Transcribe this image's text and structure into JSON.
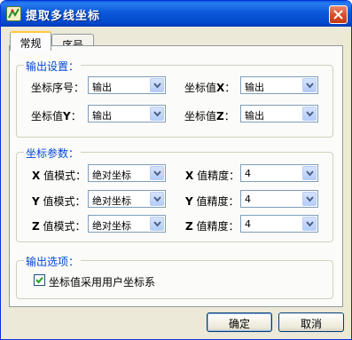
{
  "window": {
    "title": "提取多线坐标"
  },
  "tabs": [
    {
      "label": "常规"
    },
    {
      "label": "序号"
    }
  ],
  "output_settings": {
    "title": "输出设置：",
    "rows": [
      {
        "label": "坐标序号：",
        "value": "输出"
      },
      {
        "label_prefix": "坐标值",
        "label_axis": "X",
        "label_suffix": "：",
        "value": "输出"
      },
      {
        "label_prefix": "坐标值",
        "label_axis": "Y",
        "label_suffix": "：",
        "value": "输出"
      },
      {
        "label_prefix": "坐标值",
        "label_axis": "Z",
        "label_suffix": "：",
        "value": "输出"
      }
    ]
  },
  "coord_params": {
    "title": "坐标参数：",
    "rows": [
      {
        "axis": "X",
        "mode_label": "值模式：",
        "mode_value": "绝对坐标",
        "precision_label": "值精度：",
        "precision_value": "4"
      },
      {
        "axis": "Y",
        "mode_label": "值模式：",
        "mode_value": "绝对坐标",
        "precision_label": "值精度：",
        "precision_value": "4"
      },
      {
        "axis": "Z",
        "mode_label": "值模式：",
        "mode_value": "绝对坐标",
        "precision_label": "值精度：",
        "precision_value": "4"
      }
    ]
  },
  "output_options": {
    "title": "输出选项：",
    "use_ucs": {
      "label": "坐标值采用用户坐标系",
      "checked": true
    }
  },
  "buttons": {
    "ok": "确定",
    "cancel": "取消"
  },
  "colors": {
    "titlebar": "#0a58d8",
    "group_title": "#0046d5",
    "dialog_bg": "#ece9d8"
  }
}
